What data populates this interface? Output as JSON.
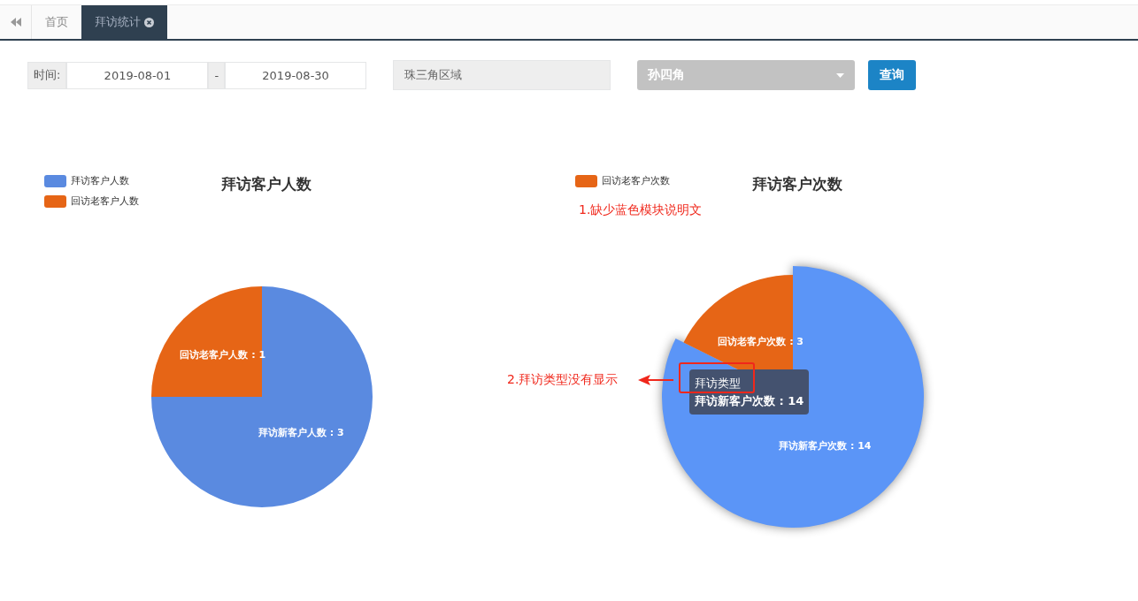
{
  "tabs": [
    {
      "label": "首页",
      "selected": false,
      "closable": false
    },
    {
      "label": "拜访统计",
      "selected": true,
      "closable": true
    }
  ],
  "filters": {
    "time_label": "时间:",
    "date_from": "2019-08-01",
    "date_separator": "-",
    "date_to": "2019-08-30",
    "region": "珠三角区域",
    "person": "孙四角",
    "query_button": "查询"
  },
  "charts": [
    {
      "legend": [
        {
          "label": "拜访客户人数",
          "color": "#5a8ae0"
        },
        {
          "label": "回访老客户人数",
          "color": "#e66516"
        }
      ],
      "slices": [
        {
          "color": "#5a8ae0",
          "selected": false
        },
        {
          "color": "#e66516",
          "selected": false
        }
      ],
      "chart_data": {
        "type": "pie",
        "title": "拜访客户人数",
        "values": [
          3,
          1
        ],
        "value_labels": [
          "拜访新客户人数 : 3",
          "回访老客户人数 : 1"
        ]
      }
    },
    {
      "legend": [
        {
          "label": "回访老客户次数",
          "color": "#e66516"
        }
      ],
      "slices": [
        {
          "color": "#5b95f7",
          "selected": true
        },
        {
          "color": "#e66516",
          "selected": false
        }
      ],
      "tooltip": {
        "title": "拜访类型",
        "text": "拜访新客户次数 : 14"
      },
      "chart_data": {
        "type": "pie",
        "title": "拜访客户次数",
        "values": [
          14,
          3
        ],
        "value_labels": [
          "拜访新客户次数 : 14",
          "回访老客户次数 : 3"
        ]
      }
    }
  ],
  "annotations": [
    {
      "kind": "note",
      "text": "1.缺少蓝色模块说明文"
    },
    {
      "kind": "arrow-note",
      "text": "2.拜访类型没有显示"
    }
  ]
}
